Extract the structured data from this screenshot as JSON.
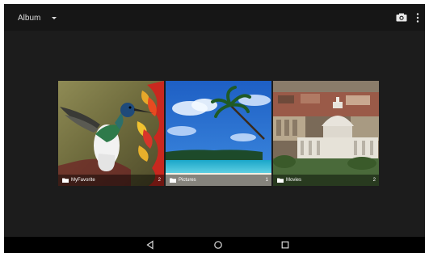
{
  "action_bar": {
    "title": "Album",
    "dropdown_icon": "caret-down-icon",
    "camera_icon": "camera-icon",
    "menu_icon": "overflow-menu-icon"
  },
  "albums": [
    {
      "name": "MyFavorite",
      "count": "2",
      "icon": "folder-icon"
    },
    {
      "name": "Pictures",
      "count": "1",
      "icon": "folder-icon"
    },
    {
      "name": "Movies",
      "count": "2",
      "icon": "folder-icon"
    }
  ],
  "navigation_bar": {
    "back_icon": "back-triangle-icon",
    "home_icon": "home-circle-icon",
    "recents_icon": "recents-square-icon"
  }
}
